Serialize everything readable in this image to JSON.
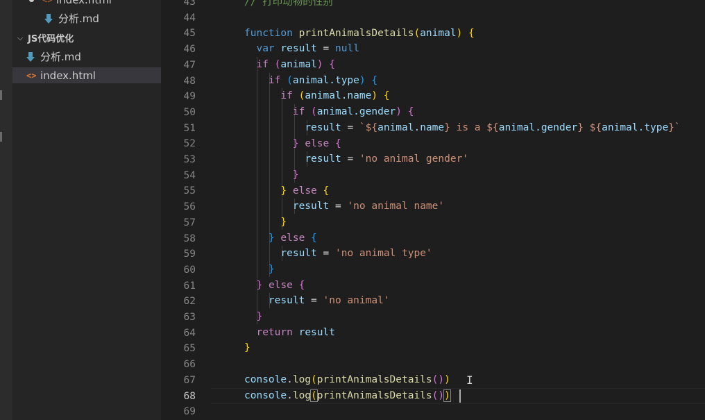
{
  "explorer": {
    "items": [
      {
        "label": "index.html",
        "kind": "html-partial"
      },
      {
        "label": "分析.md",
        "kind": "md"
      },
      {
        "label": "JS代码优化",
        "kind": "folder"
      },
      {
        "label": "分析.md",
        "kind": "md"
      },
      {
        "label": "index.html",
        "kind": "html",
        "selected": true
      }
    ],
    "folder_chevron": "⌵"
  },
  "editor": {
    "line_numbers": [
      "43",
      "44",
      "45",
      "46",
      "47",
      "48",
      "49",
      "50",
      "51",
      "52",
      "53",
      "54",
      "55",
      "56",
      "57",
      "58",
      "59",
      "60",
      "61",
      "62",
      "63",
      "64",
      "65",
      "66",
      "67",
      "68",
      "69"
    ],
    "active_line": "68",
    "comment_line_43": "// 打印动物的性别",
    "tokens": {
      "function": "function",
      "func_name": "printAnimalsDetails",
      "param": "animal",
      "var": "var",
      "result": "result",
      "null": "null",
      "if": "if",
      "else": "else",
      "return": "return",
      "animal_type": "animal.type",
      "animal_name": "animal.name",
      "animal_gender": "animal.gender",
      "template_open": "`${",
      "tpl_name": "animal.name",
      "tpl_is_a": "} is a ${",
      "tpl_gender": "animal.gender",
      "tpl_mid": "} ${",
      "tpl_type": "animal.type",
      "tpl_close": "}`",
      "str_no_gender": "'no animal gender'",
      "str_no_name": "'no animal name'",
      "str_no_type": "'no animal type'",
      "str_no_animal": "'no animal'",
      "console": "console",
      "log": "log"
    }
  },
  "cursor": {
    "ibeam": "I"
  }
}
